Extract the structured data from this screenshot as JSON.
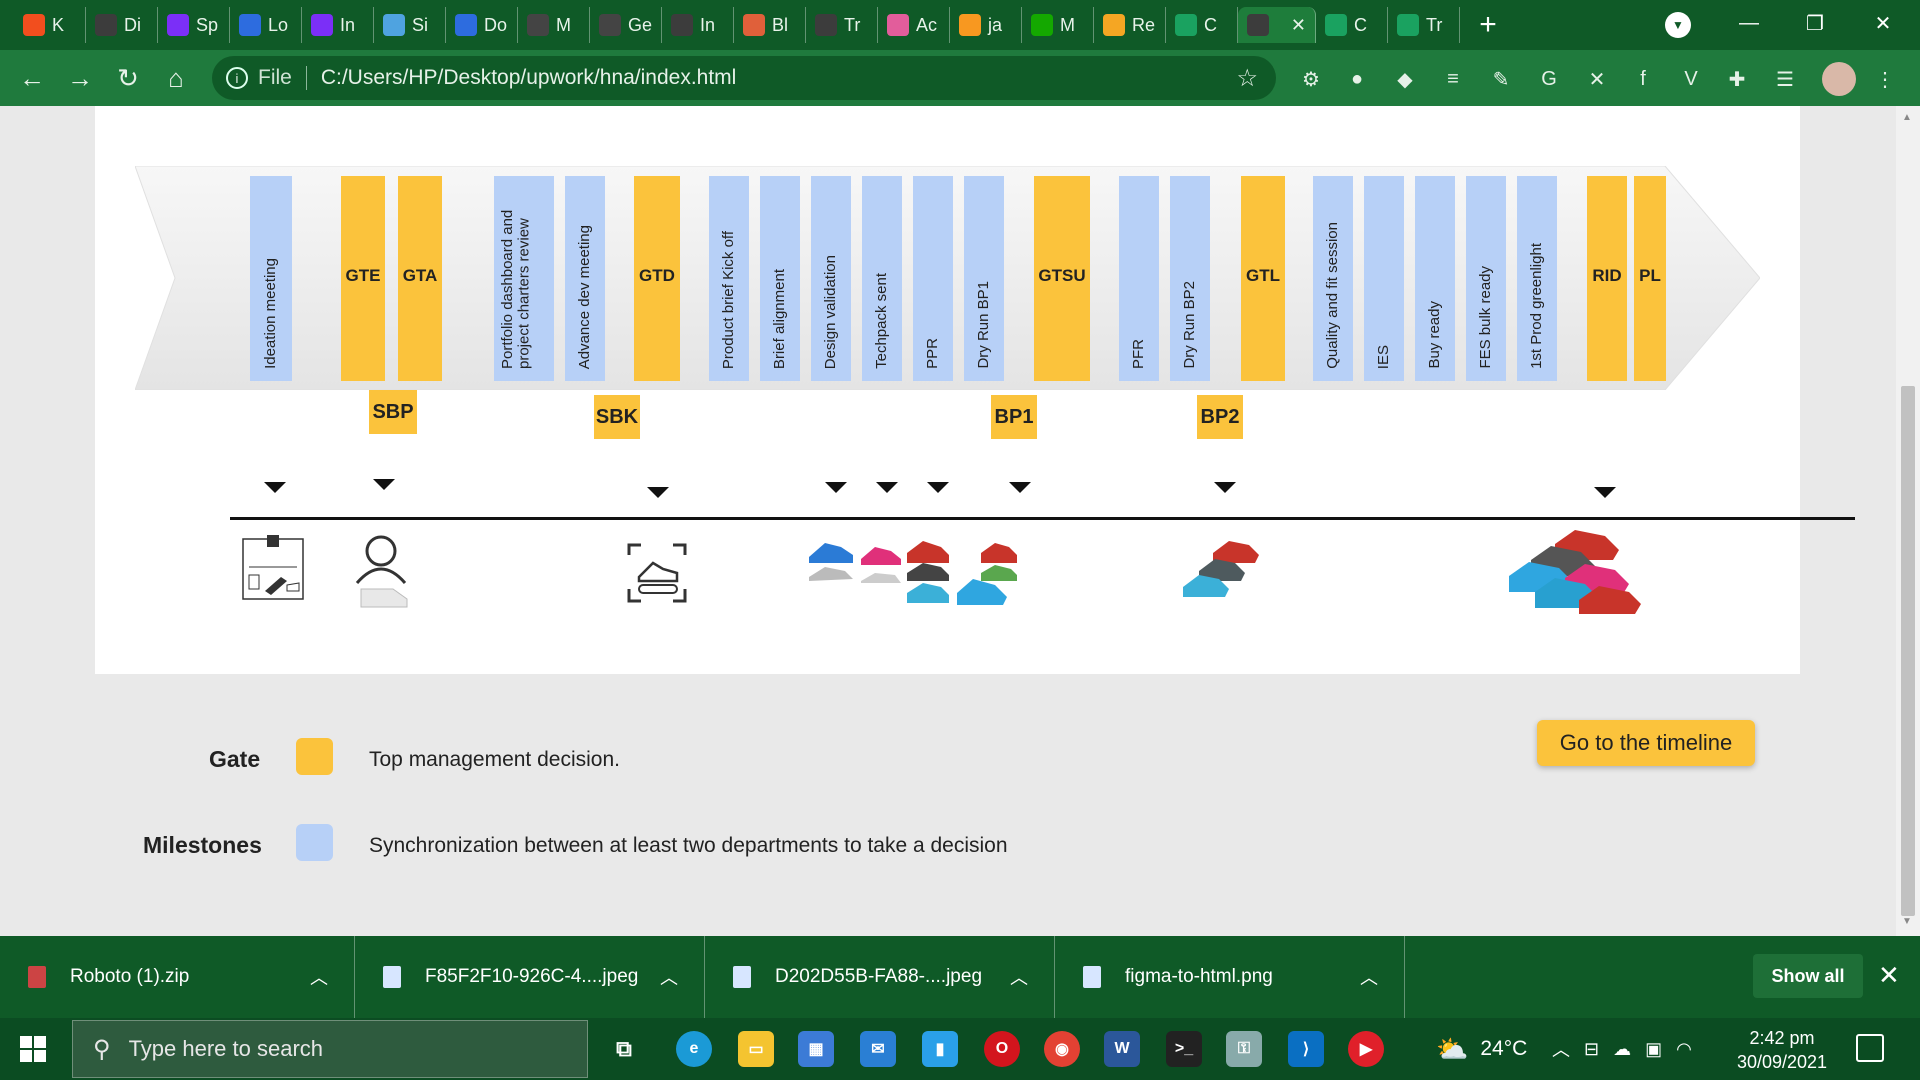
{
  "browser": {
    "tabs": [
      {
        "title": "K",
        "color": "#f24e1e"
      },
      {
        "title": "Di",
        "color": "#3c3c3c"
      },
      {
        "title": "Sp",
        "color": "#7b2ff7"
      },
      {
        "title": "Lo",
        "color": "#2d6cdf"
      },
      {
        "title": "In",
        "color": "#7b2ff7"
      },
      {
        "title": "Si",
        "color": "#4fa3e0"
      },
      {
        "title": "Do",
        "color": "#2d6cdf"
      },
      {
        "title": "M",
        "color": "#444444"
      },
      {
        "title": "Ge",
        "color": "#444444"
      },
      {
        "title": "In",
        "color": "#3c3c3c"
      },
      {
        "title": "Bl",
        "color": "#e0603a"
      },
      {
        "title": "Tr",
        "color": "#3c3c3c"
      },
      {
        "title": "Ac",
        "color": "#e25d9b"
      },
      {
        "title": "ja",
        "color": "#f89820"
      },
      {
        "title": "M",
        "color": "#14a800"
      },
      {
        "title": "Re",
        "color": "#f5a623"
      },
      {
        "title": "C",
        "color": "#1aa260"
      },
      {
        "title": "",
        "color": "#3c3c3c",
        "active": true
      },
      {
        "title": "C",
        "color": "#1aa260"
      },
      {
        "title": "Tr",
        "color": "#1aa260"
      }
    ],
    "new_tab": "+",
    "url_scheme": "File",
    "url": "C:/Users/HP/Desktop/upwork/hna/index.html",
    "window_controls": {
      "minimize": "—",
      "restore": "❐",
      "close": "✕"
    }
  },
  "process": {
    "items": [
      {
        "label": "Ideation meeting",
        "type": "milestone"
      },
      {
        "label": "GTE",
        "type": "gate"
      },
      {
        "label": "GTA",
        "type": "gate"
      },
      {
        "label": "Portfolio dashboard and project charters review",
        "type": "milestone"
      },
      {
        "label": "Advance dev meeting",
        "type": "milestone"
      },
      {
        "label": "GTD",
        "type": "gate"
      },
      {
        "label": "Product brief Kick off",
        "type": "milestone"
      },
      {
        "label": "Brief alignment",
        "type": "milestone"
      },
      {
        "label": "Design validation",
        "type": "milestone"
      },
      {
        "label": "Techpack sent",
        "type": "milestone"
      },
      {
        "label": "PPR",
        "type": "milestone"
      },
      {
        "label": "Dry Run BP1",
        "type": "milestone"
      },
      {
        "label": "GTSU",
        "type": "gate"
      },
      {
        "label": "PFR",
        "type": "milestone"
      },
      {
        "label": "Dry Run BP2",
        "type": "milestone"
      },
      {
        "label": "GTL",
        "type": "gate"
      },
      {
        "label": "Quality and fit session",
        "type": "milestone"
      },
      {
        "label": "IES",
        "type": "milestone"
      },
      {
        "label": "Buy ready",
        "type": "milestone"
      },
      {
        "label": "FES bulk ready",
        "type": "milestone"
      },
      {
        "label": "1st Prod greenlight",
        "type": "milestone"
      },
      {
        "label": "RID",
        "type": "gate"
      },
      {
        "label": "PL",
        "type": "gate"
      }
    ],
    "phases": [
      "SBP",
      "SBK",
      "BP1",
      "BP2"
    ]
  },
  "legend": {
    "gate": {
      "label": "Gate",
      "description": "Top management decision.",
      "color": "#fbc33c"
    },
    "milestone": {
      "label": "Milestones",
      "description": "Synchronization between at least two departments to take a decision",
      "color": "#b7d0f7"
    }
  },
  "cta": {
    "label": "Go to the timeline"
  },
  "downloads": {
    "items": [
      {
        "name": "Roboto (1).zip"
      },
      {
        "name": "F85F2F10-926C-4....jpeg"
      },
      {
        "name": "D202D55B-FA88-....jpeg"
      },
      {
        "name": "figma-to-html.png"
      }
    ],
    "show_all": "Show all"
  },
  "taskbar": {
    "search_placeholder": "Type here to search",
    "weather": "24°C",
    "time": "2:42 pm",
    "date": "30/09/2021"
  },
  "colors": {
    "gate": "#fbc33c",
    "milestone": "#b7d0f7",
    "chrome": "#0f5a27"
  }
}
